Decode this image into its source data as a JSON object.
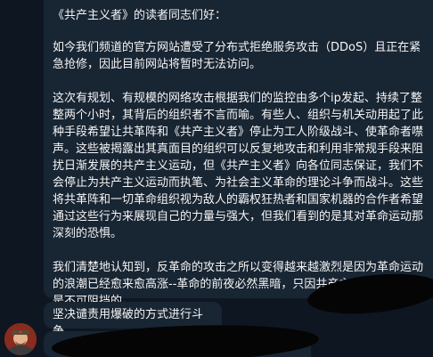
{
  "messages": {
    "main": {
      "greeting": "《共产主义者》的读者同志们好：",
      "p1": "如今我们频道的官方网站遭受了分布式拒绝服务攻击（DDoS）且正在紧急抢修，因此目前网站将暂时无法访问。",
      "p2": "这次有规划、有规模的网络攻击根据我们的监控由多个ip发起、持续了整整两个小时，其背后的组织者不言而喻。有些人、组织与机关动用起了此种手段希望让共革阵和《共产主义者》停止为工人阶级战斗、使革命者噤声。这些被揭露出其真面目的组织可以反复地攻击和利用非常规手段来阻扰日渐发展的共产主义运动，但《共产主义者》向各位同志保证，我们不会停止为共产主义运动而执笔、为社会主义革命的理论斗争而战斗。这些将共革阵和一切革命组织视为敌人的霸权狂热者和国家机器的合作者希望通过这些行为来展现自己的力量与强大，但我们看到的是其对革命运动那深刻的恐惧。",
      "p3": "我们清楚地认知到，反革命的攻击之所以变得越来越激烈是因为革命运动的浪潮已经愈来愈高涨--革命的前夜必然黑暗，只因共产主义运动的光明是不可阻挡的。"
    },
    "second": {
      "text": "坚决谴责用爆破的方式进行斗争"
    }
  },
  "avatar": {
    "icon": "profile-avatar-icon",
    "bg_color": "#8a2b1f"
  },
  "colors": {
    "background": "#0e1621",
    "bubble": "#182533",
    "text": "#f5f5f5"
  }
}
